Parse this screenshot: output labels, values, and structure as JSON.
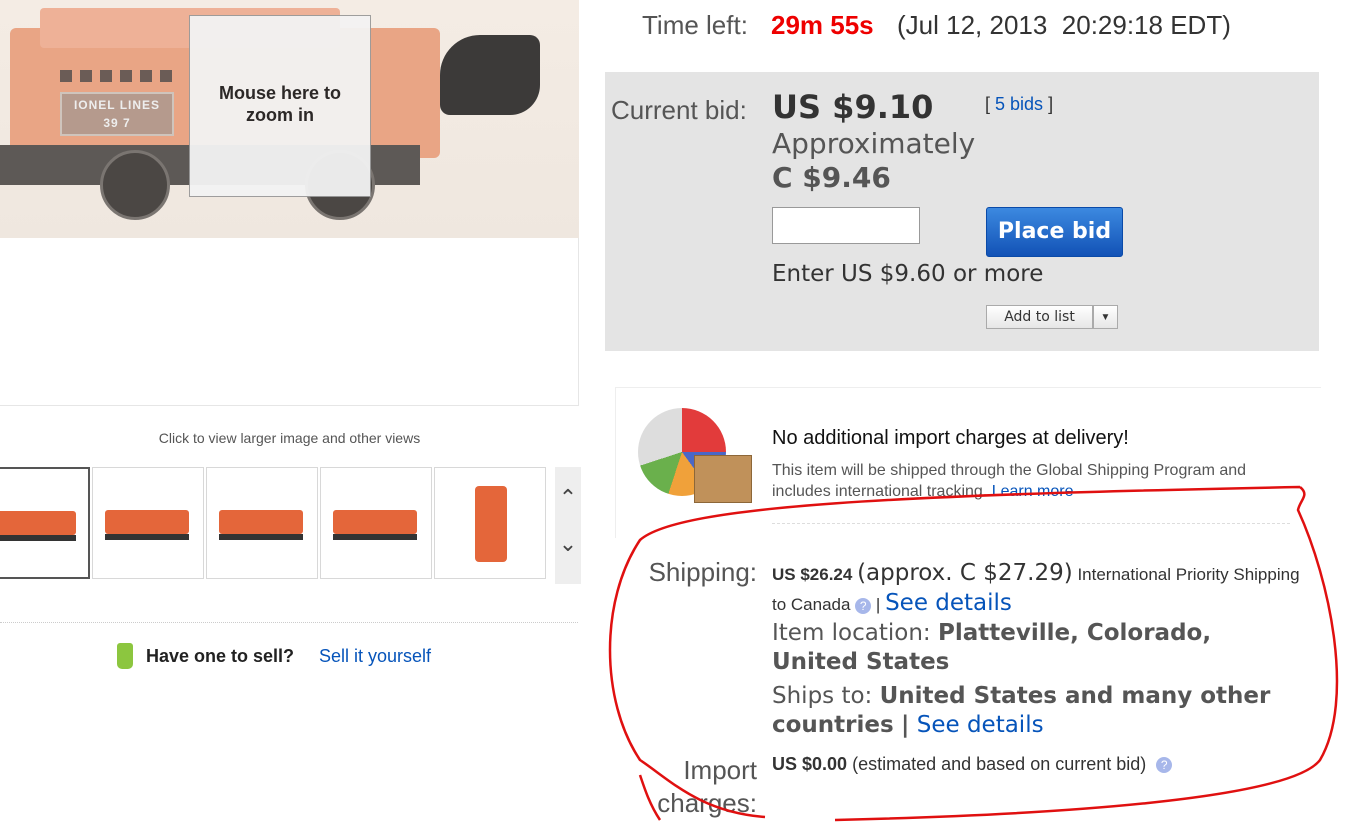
{
  "image_viewer": {
    "zoom_hint": "Mouse here to zoom in",
    "plate_text": "IONEL LINES",
    "plate_number": "39 7",
    "caption": "Click to view larger image and other views",
    "thumbnails": [
      {
        "label": "thumbnail 1"
      },
      {
        "label": "thumbnail 2"
      },
      {
        "label": "thumbnail 3"
      },
      {
        "label": "thumbnail 4"
      },
      {
        "label": "thumbnail 5"
      }
    ],
    "scroll_up_icon": "chevron-up-icon",
    "scroll_down_icon": "chevron-down-icon"
  },
  "sell": {
    "icon": "price-tag-icon",
    "label": "Have one to sell?",
    "link": "Sell it yourself"
  },
  "auction": {
    "time_label": "Time left:",
    "time_left": "29m 55s",
    "end_time": "(Jul 12, 2013  20:29:18 EDT)",
    "current_bid_label": "Current bid:",
    "current_bid": "US $9.10",
    "bid_count": "5 bids",
    "approx_label": "Approximately",
    "approx_amount": "C $9.46",
    "bid_input_value": "",
    "place_bid": "Place bid",
    "bid_hint": "Enter US $9.60 or more",
    "add_to_list": "Add to list"
  },
  "global_shipping": {
    "icon": "globe-package-icon",
    "title": "No additional import charges at delivery!",
    "text": "This item will be shipped through the Global Shipping Program and includes international tracking.",
    "learn_more": "Learn more"
  },
  "shipping": {
    "label": "Shipping:",
    "cost": "US $26.24",
    "approx": "(approx. C $27.29)",
    "service": "International Priority Shipping to Canada",
    "see_details": "See details",
    "location_label": "Item location:",
    "location": "Platteville, Colorado, United States",
    "ships_to_label": "Ships to:",
    "ships_to": "United States and many other countries",
    "ships_to_separator": "|",
    "see_details_2": "See details"
  },
  "import": {
    "label": "Import charges:",
    "amount": "US $0.00",
    "note": "(estimated and based on current bid)"
  },
  "colors": {
    "time_left": "#ee0000",
    "link": "#0654ba",
    "place_bid_button": "#1a5fc4",
    "annotation_circle": "#e01010"
  }
}
